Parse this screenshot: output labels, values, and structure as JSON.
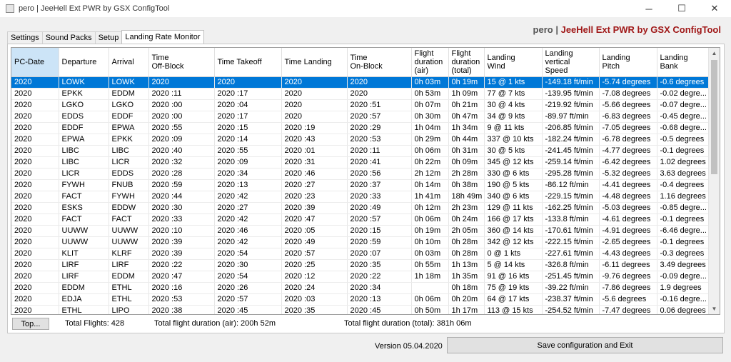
{
  "window": {
    "title": "pero | JeeHell Ext PWR by GSX  ConfigTool",
    "minimize": "─",
    "maximize": "☐",
    "close": "✕"
  },
  "brand": {
    "user": "pero",
    "separator": "|",
    "name": "JeeHell Ext PWR by GSX ConfigTool"
  },
  "tabs": [
    {
      "label": "Settings"
    },
    {
      "label": "Sound Packs"
    },
    {
      "label": "Setup"
    },
    {
      "label": "Landing Rate Monitor"
    }
  ],
  "columns": [
    "PC-Date",
    "Departure",
    "Arrival",
    "Time\nOff-Block",
    "Time Takeoff",
    "Time Landing",
    "Time\nOn-Block",
    "Flight\nduration\n(air)",
    "Flight\nduration\n(total)",
    "Landing\nWind",
    "Landing\nvertical\nSpeed",
    "Landing\nPitch",
    "Landing\nBank"
  ],
  "rows": [
    [
      "2020",
      "LOWK",
      "LOWK",
      "2020",
      "2020",
      "2020",
      "2020",
      "0h 03m",
      "0h 19m",
      "15 @ 1 kts",
      "-149.18 ft/min",
      "-5.74 degrees",
      "-0.6 degrees"
    ],
    [
      "2020",
      "EPKK",
      "EDDM",
      "2020 :11",
      "2020 :17",
      "2020",
      "2020",
      "0h 53m",
      "1h 09m",
      "77 @ 7 kts",
      "-139.95 ft/min",
      "-7.08 degrees",
      "-0.02 degre..."
    ],
    [
      "2020",
      "LGKO",
      "LGKO",
      "2020 :00",
      "2020 :04",
      "2020",
      "2020 :51",
      "0h 07m",
      "0h 21m",
      "30 @ 4 kts",
      "-219.92 ft/min",
      "-5.66 degrees",
      "-0.07 degre..."
    ],
    [
      "2020",
      "EDDS",
      "EDDF",
      "2020 :00",
      "2020 :17",
      "2020",
      "2020 :57",
      "0h 30m",
      "0h 47m",
      "34 @ 9 kts",
      "-89.97 ft/min",
      "-6.83 degrees",
      "-0.45 degre..."
    ],
    [
      "2020",
      "EDDF",
      "EPWA",
      "2020 :55",
      "2020 :15",
      "2020 :19",
      "2020 :29",
      "1h 04m",
      "1h 34m",
      "9 @ 11 kts",
      "-206.85 ft/min",
      "-7.05 degrees",
      "-0.68 degre..."
    ],
    [
      "2020",
      "EPWA",
      "EPKK",
      "2020 :09",
      "2020 :14",
      "2020 :43",
      "2020 :53",
      "0h 29m",
      "0h 44m",
      "337 @ 10 kts",
      "-182.24 ft/min",
      "-6.78 degrees",
      "-0.5 degrees"
    ],
    [
      "2020",
      "LIBC",
      "LIBC",
      "2020 :40",
      "2020 :55",
      "2020 :01",
      "2020 :11",
      "0h 06m",
      "0h 31m",
      "30 @ 5 kts",
      "-241.45 ft/min",
      "-4.77 degrees",
      "-0.1 degrees"
    ],
    [
      "2020",
      "LIBC",
      "LICR",
      "2020 :32",
      "2020 :09",
      "2020 :31",
      "2020 :41",
      "0h 22m",
      "0h 09m",
      "345 @ 12 kts",
      "-259.14 ft/min",
      "-6.42 degrees",
      "1.02 degrees"
    ],
    [
      "2020",
      "LICR",
      "EDDS",
      "2020 :28",
      "2020 :34",
      "2020 :46",
      "2020 :56",
      "2h 12m",
      "2h 28m",
      "330 @ 6 kts",
      "-295.28 ft/min",
      "-5.32 degrees",
      "3.63 degrees"
    ],
    [
      "2020",
      "FYWH",
      "FNUB",
      "2020 :59",
      "2020 :13",
      "2020 :27",
      "2020 :37",
      "0h 14m",
      "0h 38m",
      "190 @ 5 kts",
      "-86.12 ft/min",
      "-4.41 degrees",
      "-0.4 degrees"
    ],
    [
      "2020",
      "FACT",
      "FYWH",
      "2020 :44",
      "2020 :42",
      "2020 :23",
      "2020 :33",
      "1h 41m",
      "18h 49m",
      "340 @ 6 kts",
      "-229.15 ft/min",
      "-4.48 degrees",
      "1.16 degrees"
    ],
    [
      "2020",
      "ESKS",
      "EDDW",
      "2020 :30",
      "2020 :27",
      "2020 :39",
      "2020 :49",
      "0h 12m",
      "2h 23m",
      "129 @ 11 kts",
      "-162.25 ft/min",
      "-5.03 degrees",
      "-0.85 degre..."
    ],
    [
      "2020",
      "FACT",
      "FACT",
      "2020 :33",
      "2020 :42",
      "2020 :47",
      "2020 :57",
      "0h 06m",
      "0h 24m",
      "166 @ 17 kts",
      "-133.8 ft/min",
      "-4.61 degrees",
      "-0.1 degrees"
    ],
    [
      "2020",
      "UUWW",
      "UUWW",
      "2020 :10",
      "2020 :46",
      "2020 :05",
      "2020 :15",
      "0h 19m",
      "2h 05m",
      "360 @ 14 kts",
      "-170.61 ft/min",
      "-4.91 degrees",
      "-6.46 degre..."
    ],
    [
      "2020",
      "UUWW",
      "UUWW",
      "2020 :39",
      "2020 :42",
      "2020 :49",
      "2020 :59",
      "0h 10m",
      "0h 28m",
      "342 @ 12 kts",
      "-222.15 ft/min",
      "-2.65 degrees",
      "-0.1 degrees"
    ],
    [
      "2020",
      "KLIT",
      "KLRF",
      "2020 :39",
      "2020 :54",
      "2020 :57",
      "2020 :07",
      "0h 03m",
      "0h 28m",
      "0 @ 1 kts",
      "-227.61 ft/min",
      "-4.43 degrees",
      "-0.3 degrees"
    ],
    [
      "2020",
      "LIRF",
      "LIRF",
      "2020 :22",
      "2020 :30",
      "2020 :25",
      "2020 :35",
      "0h 55m",
      "1h 13m",
      "5 @ 14 kts",
      "-326.8 ft/min",
      "-6.11 degrees",
      "3.49 degrees"
    ],
    [
      "2020",
      "LIRF",
      "EDDM",
      "2020 :47",
      "2020 :54",
      "2020 :12",
      "2020 :22",
      "1h 18m",
      "1h 35m",
      "91 @ 16 kts",
      "-251.45 ft/min",
      "-9.76 degrees",
      "-0.09 degre..."
    ],
    [
      "2020",
      "EDDM",
      "ETHL",
      "2020 :16",
      "2020 :26",
      "2020 :24",
      "2020 :34",
      "",
      "0h 18m",
      "75 @ 19 kts",
      "-39.22 ft/min",
      "-7.86 degrees",
      "1.9 degrees"
    ],
    [
      "2020",
      "EDJA",
      "ETHL",
      "2020 :53",
      "2020 :57",
      "2020 :03",
      "2020 :13",
      "0h 06m",
      "0h 20m",
      "64 @ 17 kts",
      "-238.37 ft/min",
      "-5.6 degrees",
      "-0.16 degre..."
    ],
    [
      "2020",
      "ETHL",
      "LIPO",
      "2020 :38",
      "2020 :45",
      "2020 :35",
      "2020 :45",
      "0h 50m",
      "1h 17m",
      "113 @ 15 kts",
      "-254.52 ft/min",
      "-7.47 degrees",
      "0.06 degrees"
    ]
  ],
  "scroll": {
    "up": "▲",
    "down": "▼"
  },
  "footer": {
    "top_button": "Top...",
    "total_flights": "Total Flights: 428",
    "total_air": "Total flight duration (air): 200h 52m",
    "total_total": "Total flight duration (total): 381h 06m"
  },
  "version": "Version 05.04.2020",
  "save_button": "Save configuration and Exit"
}
